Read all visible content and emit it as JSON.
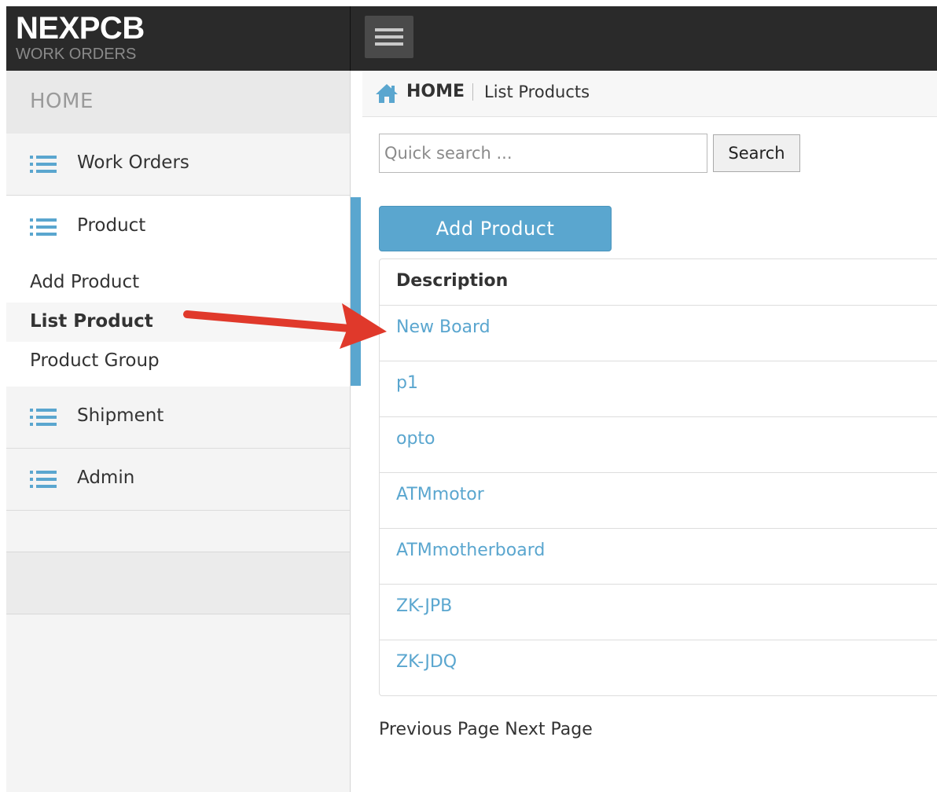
{
  "brand": {
    "name": "NEXPCB",
    "subtitle": "WORK ORDERS"
  },
  "sidebar": {
    "home_label": "HOME",
    "items": [
      {
        "label": "Work Orders",
        "icon": "list-icon"
      },
      {
        "label": "Product",
        "icon": "list-icon",
        "subitems": [
          {
            "label": "Add Product",
            "active": false
          },
          {
            "label": "List Product",
            "active": true
          },
          {
            "label": "Product Group",
            "active": false
          }
        ]
      },
      {
        "label": "Shipment",
        "icon": "list-icon"
      },
      {
        "label": "Admin",
        "icon": "list-icon"
      }
    ]
  },
  "breadcrumb": {
    "home": "HOME",
    "current": "List Products"
  },
  "search": {
    "placeholder": "Quick search ...",
    "button": "Search"
  },
  "add_button": "Add Product",
  "table": {
    "header": "Description",
    "rows": [
      "New Board",
      "p1",
      "opto",
      "ATMmotor",
      "ATMmotherboard",
      "ZK-JPB",
      "ZK-JDQ"
    ]
  },
  "pagination": {
    "previous": "Previous Page",
    "next": "Next Page"
  },
  "colors": {
    "accent": "#5aa6cf",
    "topbar": "#2a2a2a",
    "annotation_arrow": "#e0392b"
  }
}
